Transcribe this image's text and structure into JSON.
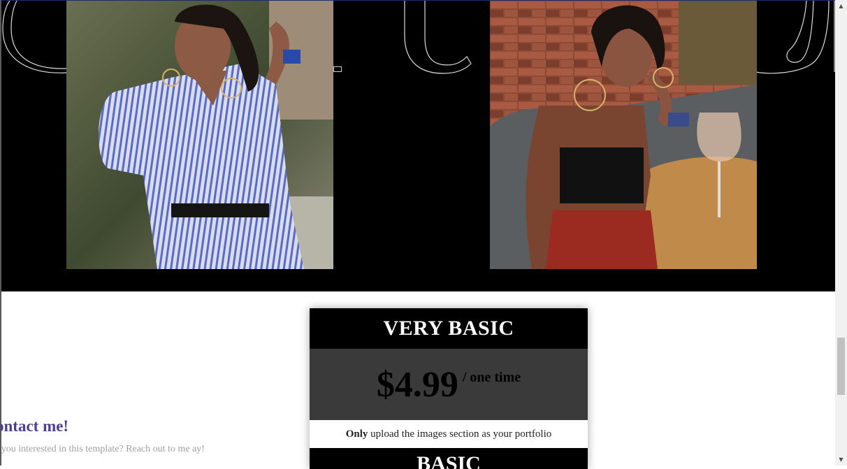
{
  "hero": {
    "background_letters": [
      "c",
      "t",
      "a"
    ],
    "photos": [
      {
        "name": "woman in striped blue shirt"
      },
      {
        "name": "woman seated at restaurant table"
      }
    ]
  },
  "pricing": {
    "plan_title": "VERY BASIC",
    "price": "$4.99",
    "period": "/ one time",
    "desc_bold": "Only",
    "desc_rest": " upload the images section as your portfolio",
    "next_plan_title": "BASIC"
  },
  "contact": {
    "title": "ontact me!",
    "text": "e you interested in this template? Reach out to me ay!"
  },
  "colors": {
    "accent": "#4b3f8f",
    "hero_bg": "#000000",
    "price_bg": "#3a3a3a"
  },
  "scrollbar": {
    "up_icon": "arrow-up-icon",
    "down_icon": "arrow-down-icon"
  }
}
